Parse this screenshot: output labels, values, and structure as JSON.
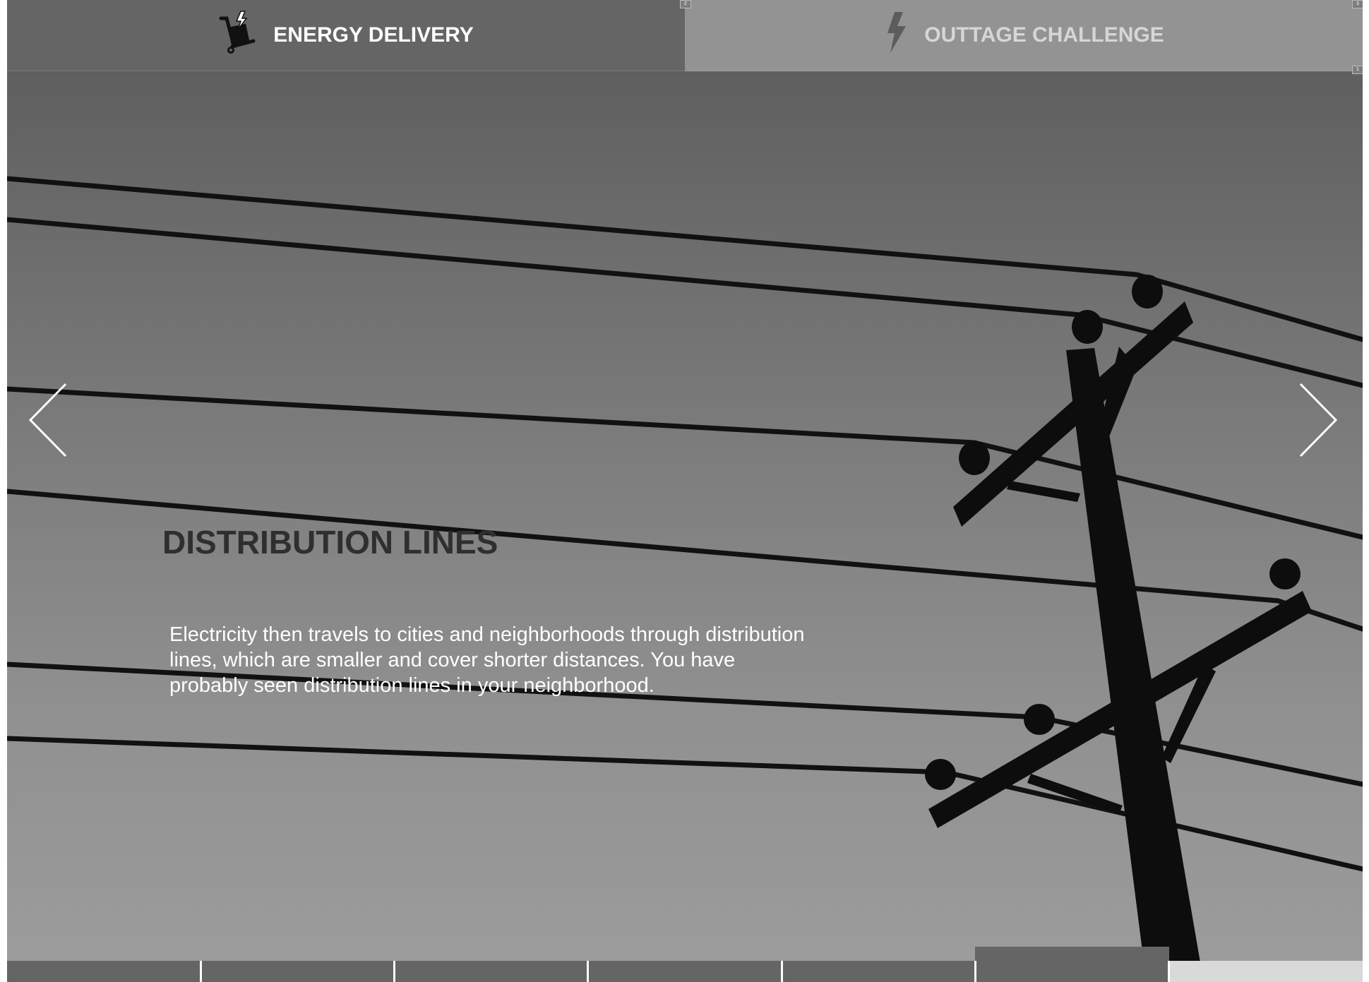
{
  "tabs": [
    {
      "label": "ENERGY DELIVERY",
      "icon": "hand-truck-icon",
      "active": true
    },
    {
      "label": "OUTTAGE CHALLENGE",
      "icon": "lightning-bolt-icon",
      "active": false
    }
  ],
  "slide": {
    "title": "DISTRIBUTION LINES",
    "body": "Electricity then travels to cities and neighborhoods through distribution lines, which are smaller and cover shorter distances. You have probably seen distribution lines in your neighborhood.",
    "background": "power-pole-photo"
  },
  "navigation": {
    "prev_icon": "chevron-left-icon",
    "next_icon": "chevron-right-icon"
  },
  "progress": {
    "total_segments": 7,
    "current_segment": 6
  },
  "markers": [
    "2",
    "3",
    "1"
  ],
  "colors": {
    "tab_active": "#656565",
    "tab_inactive": "#939393",
    "title": "#2f2f2f",
    "body_text": "#ffffff"
  }
}
